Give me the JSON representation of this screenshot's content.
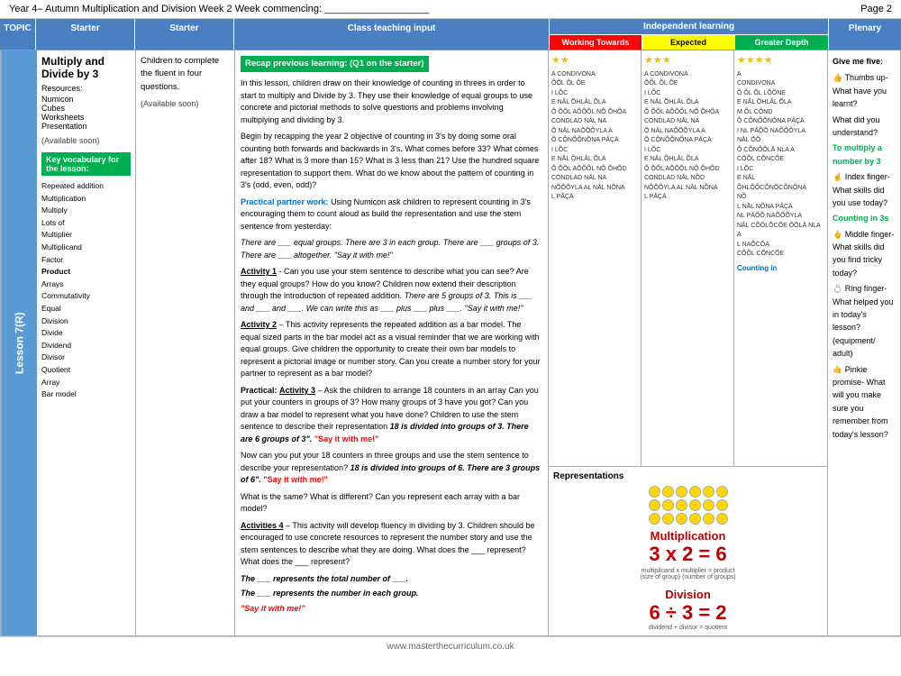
{
  "header": {
    "title": "Year 4– Autumn Multiplication and Division Week 2   Week commencing: ___________________",
    "page": "Page 2"
  },
  "columns": {
    "lesson": "TOPIC",
    "starter": "Starter",
    "teaching": "Class teaching input",
    "independent": "Independent learning",
    "plenary": "Plenary"
  },
  "independent_sub": {
    "working_towards": "Working Towards",
    "expected": "Expected",
    "greater_depth": "Greater Depth"
  },
  "lesson_content": {
    "lesson_number": "Lesson 7(R)",
    "title": "Multiply and Divide by 3",
    "resources_label": "Resources:",
    "resources": [
      "Numicon",
      "Cubes",
      "Worksheets",
      "Presentation"
    ],
    "available": "(Available soon)",
    "vocab_label": "Key vocabulary for the lesson:",
    "vocab_items": [
      "Repeated addition",
      "Multiplication",
      "Multiply",
      "Lots of",
      "Multiplier",
      "Multiplicand",
      "Factor",
      "Product",
      "Arrays",
      "Commutativity",
      "Equal",
      "Division",
      "Divide",
      "Dividend",
      "Divisor",
      "Quotient",
      "Array",
      "Bar model"
    ]
  },
  "starter": {
    "text": "Children to complete the fluent in four questions.",
    "available": "(Available soon)"
  },
  "teaching": {
    "recap_label": "Recap previous learning: (Q1 on the starter)",
    "intro": "In this lesson, children draw on their knowledge of counting in threes in order to start to multiply and Divide by 3. They use their knowledge of equal groups to use concrete and pictorial methods to solve questions and problems involving multiplying and dividing by 3.",
    "begin": "Begin by recapping the year 2 objective of counting in 3's by  doing some oral counting both forwards and backwards in 3's.  What comes before 33?  What comes after 18?  What is 3 more than 15? What is 3 less than 21?  Use the hundred square representation to support them.  What do we know about the pattern of counting in 3's (odd, even, odd)?",
    "partner_label": "Practical partner work:",
    "partner_text": " Using Numicon ask children to represent counting in 3's encouraging them to count aloud as build the representation and use the stem sentence from yesterday:",
    "stem1": "There are ___ equal groups. There are 3 in each group.  There are ___ groups of 3. There are ___ altogether. \"Say it with me!\"",
    "activity1_label": "Activity 1",
    "activity1": " - Can you use your stem sentence to describe what you can see?  Are they equal groups? How do you know?  Children now extend their description  through the introduction of repeated addition. ",
    "activity1_italic": "There are 5 groups of 3. This is ___ and ___ and ___. We can write this as ___ plus ___ plus ___.  \"Say it with me!\"",
    "activity2_label": "Activity 2",
    "activity2": " – This activity represents the repeated addition as a bar model.  The equal sized parts in the bar model act as a visual reminder that we are working with equal groups.  Give children the opportunity to create their own bar models to represent a pictorial image or number story. Can you create a number story for your partner to represent as a bar model?",
    "practical_label": "Practical:",
    "activity3_label": "Activity 3",
    "activity3": " – Ask the children to arrange 18 counters in an array  Can you put your counters in groups of 3?  How many groups of 3 have you got?  Can you draw a bar model to represent  what you have done? Children to use the stem sentence to describe their representation  ",
    "activity3_italic1": "18 is divided into groups of 3. There are 6 groups of 3\".",
    "activity3_saywith1": " \"Say it with me!\"",
    "activity3_cont": "Now can you put your 18 counters in three groups and use the stem sentence to describe your representation? ",
    "activity3_italic2": "18 is divided into groups of 6. There are 3 groups of 6\".",
    "activity3_saywith2": " \"Say it with me!\"",
    "activity3_question": "What is the same? What is different?  Can you represent each array with a bar model?",
    "activity4_label": "Activities 4",
    "activity4": " – This activity will develop fluency in dividing by 3. Children should be encouraged to use concrete resources to represent the number story and use the stem sentences to describe what they are doing. What does the ___ represent? What does the ___ represent?",
    "the1": "The ___ represents the total number of ___.",
    "the2": "The ___ represents the number in each group.",
    "saywith3": " \"Say it with me!\""
  },
  "working_towards": {
    "stars": "★★",
    "content_lines": [
      "A CONDIVONA",
      "ÕÕL ÕL ÕE",
      "I LÕC",
      "E NÅL ÕHLÅL ÕLA",
      "Õ ÕÕL AÕÕÕL NÕ ÕHÕA",
      "CONDLAD NÅL NA",
      "Õ NÅL NAÕÕÕYLA A",
      "Õ CÕNÕÕNÕNA PÅÇÄ",
      "I LÕC",
      "E NÅL ÕHLÅL ÕLA",
      "Õ ÕÕL AÕÕÕL NÕ ÕHÕD",
      "CONDLAD NÅL NA",
      "NÕÕÕYLA AL NÅL NÕNA",
      "L PÅÇÄ"
    ]
  },
  "expected": {
    "stars": "★★★",
    "content_lines": [
      "A CONDIVONA",
      "ÕÕL ÕL ÕE",
      "I LÕC",
      "E NÅL ÕHLÅL ÕLA",
      "Õ ÕÕL AÕÕÕL NÕ ÕHÕA",
      "CONDLAD NÅL NA",
      "Õ NÅL NAÕÕÕYLA A",
      "Õ CÕNÕÕNÕNA PÅÇÄ",
      "I LÕC",
      "E NÅL ÕHLÅL ÕLA",
      "Õ ÕÕL AÕÕÕL NÕ ÕHÕD",
      "CONDLAD NÅL NÕD",
      "NÕÕÕYLA AL NÅL NÕNA",
      "L PÅÇÄ"
    ]
  },
  "greater_depth": {
    "stars": "★★★★",
    "content_lines": [
      "A",
      "CONDIVONA",
      "Õ ÕL ÕL LÕÕNE",
      "E NÅL ÕHLÅL ÕLA",
      "M ÕL CÕND",
      "Õ CÕNÕÕNÕNA PÅÇÄ",
      "I NL PÅÕÕ NAÕÕÕYLA",
      "NÅL ÕÕ",
      "Õ CÕNÕÕLÅ NLA A",
      "CÕÕL CÕNCÕE",
      "I LÕC",
      "E NÅL ÕHLÕÕCÕNÕCÕNÕNA",
      "NÕ",
      "L NÅL NÕNA PÅÇÄ",
      "NL PÅÕÕ NAÕÕÕYLA",
      "NÅL CÕÕLÕCÕE ÕÕLÅ NLA A",
      "L NAÕCÕA",
      "CÕÕL CÕNCÕE"
    ]
  },
  "representations": {
    "label": "Representations",
    "multiplication_label": "Multiplication",
    "equation": "3 x 2 = 6",
    "multiplicand_label": "multiplicand x multiplier = product",
    "size_label": "(size of group)    (number of groups)",
    "division_label": "Division",
    "div_equation": "6 ÷ 3 = 2",
    "div_labels": "dividend + divisor = quotient",
    "counting_in": "Counting in"
  },
  "plenary": {
    "intro": "Give me five:",
    "thumb_icon": "👍",
    "thumb_label": "Thumbs up- What have you learnt?",
    "index_question": "What did you understand?",
    "green_text": "To multiply a number by 3",
    "index_icon": "☝",
    "index_label": "Index finger- What skills did you use today?",
    "counting_green": "Counting in 3s",
    "middle_icon": "🖕",
    "middle_label": "Middle finger- What skills did you find tricky today?",
    "ring_icon": "💍",
    "ring_label": "Ring finger- What helped you in today's lesson? (equipment/ adult)",
    "pinkie_icon": "🤙",
    "pinkie_label": "Pinkie promise- What will you make sure you remember from today's lesson?"
  },
  "footer": {
    "url": "www.masterthecurriculum.co.uk"
  }
}
